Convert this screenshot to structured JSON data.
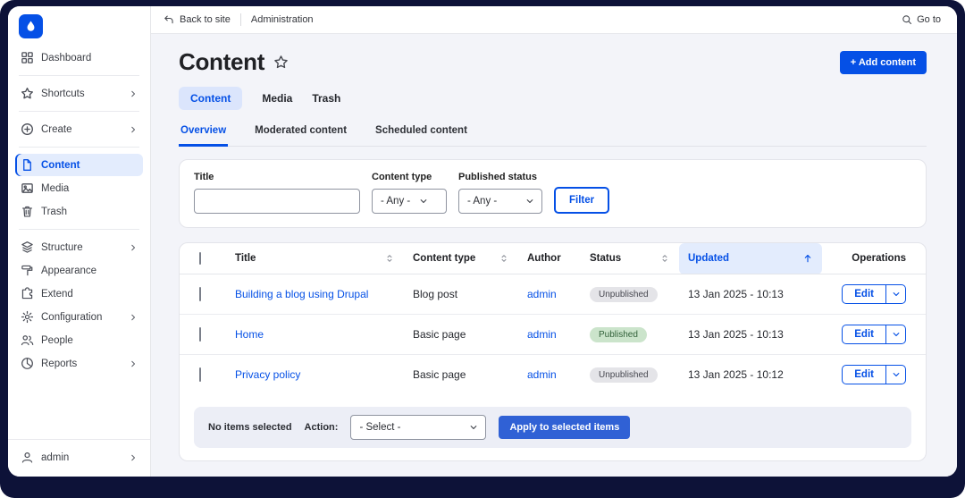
{
  "topbar": {
    "back_label": "Back to site",
    "breadcrumb": "Administration",
    "goto_label": "Go to"
  },
  "sidebar": {
    "items": [
      {
        "label": "Dashboard"
      },
      {
        "label": "Shortcuts"
      },
      {
        "label": "Create"
      },
      {
        "label": "Content"
      },
      {
        "label": "Media"
      },
      {
        "label": "Trash"
      },
      {
        "label": "Structure"
      },
      {
        "label": "Appearance"
      },
      {
        "label": "Extend"
      },
      {
        "label": "Configuration"
      },
      {
        "label": "People"
      },
      {
        "label": "Reports"
      }
    ],
    "footer_label": "admin"
  },
  "page": {
    "title": "Content",
    "add_button": "+ Add content"
  },
  "primary_tabs": {
    "content": "Content",
    "media": "Media",
    "trash": "Trash"
  },
  "secondary_tabs": {
    "overview": "Overview",
    "moderated": "Moderated content",
    "scheduled": "Scheduled content"
  },
  "filters": {
    "title_label": "Title",
    "content_type_label": "Content type",
    "content_type_value": "- Any -",
    "published_status_label": "Published status",
    "published_status_value": "- Any -",
    "filter_button": "Filter"
  },
  "table": {
    "headers": {
      "title": "Title",
      "content_type": "Content type",
      "author": "Author",
      "status": "Status",
      "updated": "Updated",
      "operations": "Operations"
    },
    "rows": [
      {
        "title": "Building a blog using Drupal",
        "content_type": "Blog post",
        "author": "admin",
        "status": "Unpublished",
        "updated": "13 Jan 2025 - 10:13",
        "edit": "Edit"
      },
      {
        "title": "Home",
        "content_type": "Basic page",
        "author": "admin",
        "status": "Published",
        "updated": "13 Jan 2025 - 10:13",
        "edit": "Edit"
      },
      {
        "title": "Privacy policy",
        "content_type": "Basic page",
        "author": "admin",
        "status": "Unpublished",
        "updated": "13 Jan 2025 - 10:12",
        "edit": "Edit"
      }
    ],
    "footer": {
      "no_items": "No items selected",
      "action_label": "Action:",
      "action_value": "- Select -",
      "apply_button": "Apply to selected items"
    }
  },
  "colors": {
    "primary": "#0550e6",
    "frame": "#0d1238",
    "active_highlight": "#e3ecfd",
    "published_badge_bg": "#cbe4cb",
    "unpublished_badge_bg": "#e4e4e8"
  }
}
